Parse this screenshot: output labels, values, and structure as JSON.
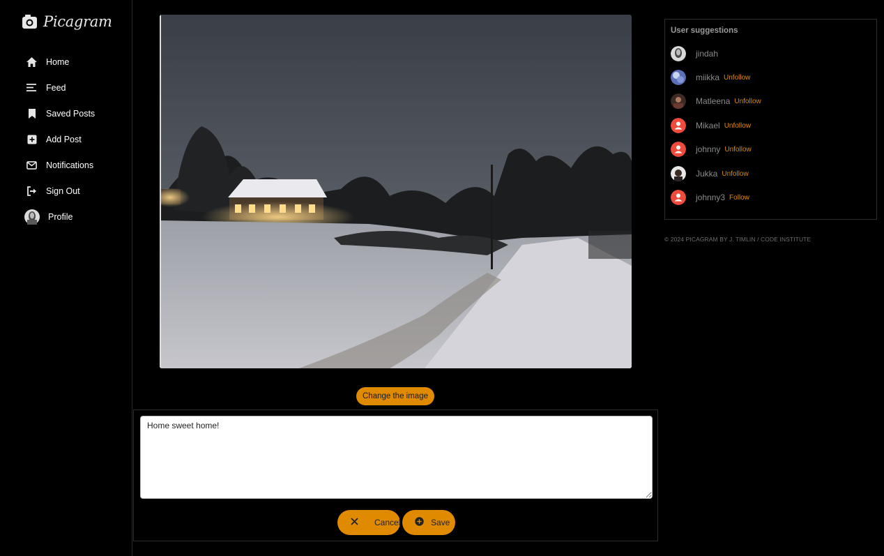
{
  "brand": {
    "name": "Picagram",
    "icon": "camera-icon"
  },
  "nav": [
    {
      "label": "Home",
      "icon": "home-icon"
    },
    {
      "label": "Feed",
      "icon": "feed-icon"
    },
    {
      "label": "Saved Posts",
      "icon": "bookmark-icon"
    },
    {
      "label": "Add Post",
      "icon": "plus-square-icon"
    },
    {
      "label": "Notifications",
      "icon": "envelope-icon"
    },
    {
      "label": "Sign Out",
      "icon": "sign-out-icon"
    },
    {
      "label": "Profile",
      "icon": "avatar-icon"
    }
  ],
  "post_form": {
    "change_image_label": "Change the image",
    "content": "Home sweet home!",
    "cancel_label": "Cancel",
    "save_label": "Save"
  },
  "suggestions": {
    "title": "User suggestions",
    "users": [
      {
        "name": "jindah",
        "action": ""
      },
      {
        "name": "miikka",
        "action": "Unfollow"
      },
      {
        "name": "Matleena",
        "action": "Unfollow"
      },
      {
        "name": "Mikael",
        "action": "Unfollow"
      },
      {
        "name": "johnny",
        "action": "Unfollow"
      },
      {
        "name": "Jukka",
        "action": "Unfollow"
      },
      {
        "name": "johnny3",
        "action": "Follow"
      }
    ]
  },
  "footer": {
    "text": "© 2024 PICAGRAM BY J. TIMLIN / CODE INSTITUTE"
  },
  "colors": {
    "accent": "#e08a00",
    "background": "#000000",
    "default_avatar": "#ee4b3c"
  }
}
